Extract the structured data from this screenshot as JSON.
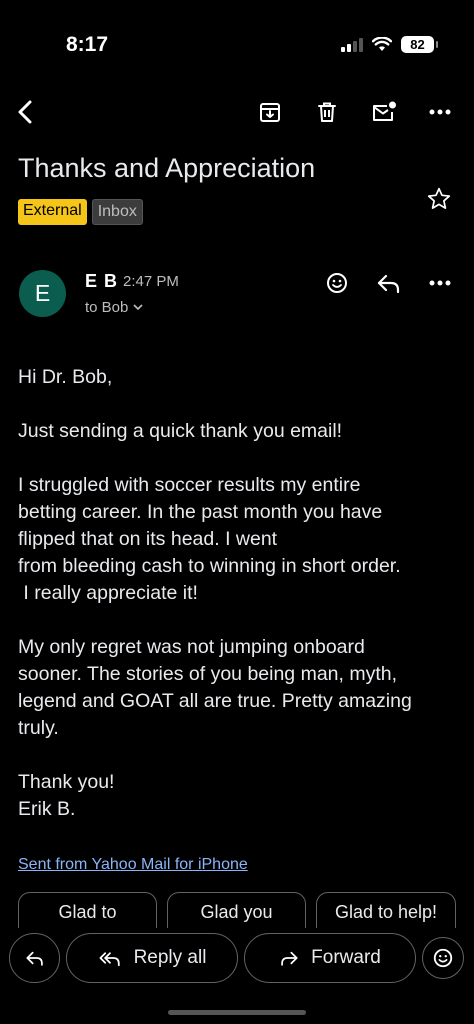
{
  "status_bar": {
    "time": "8:17",
    "battery": "82"
  },
  "toolbar": {
    "back": "back-arrow-icon",
    "archive": "archive-icon",
    "delete": "trash-icon",
    "mark_unread": "mark-unread-icon",
    "more": "more-icon"
  },
  "email": {
    "subject": "Thanks and Appreciation",
    "labels": [
      "External",
      "Inbox"
    ],
    "sender": {
      "initial": "E",
      "name": "E B",
      "time": "2:47 PM",
      "recipient": "to Bob"
    },
    "body": {
      "greeting": "Hi Dr. Bob,",
      "p1": "Just sending a quick thank you email!",
      "p2": [
        "I struggled with soccer results my entire",
        "betting career.  In the past month you have",
        "flipped that on its head.  I went",
        "from bleeding cash to winning in short order.",
        " I really appreciate it!"
      ],
      "p3": [
        "My only regret was not jumping onboard",
        "sooner.  The stories of you being  man, myth,",
        "legend and GOAT all are true. Pretty amazing",
        "truly."
      ],
      "signoff": "Thank you!",
      "signature": "Erik B."
    },
    "footer_link": "Sent from Yahoo Mail for iPhone"
  },
  "smart_replies": [
    "Glad to",
    "Glad you",
    "Glad to help!"
  ],
  "actions": {
    "reply_all": "Reply all",
    "forward": "Forward"
  }
}
